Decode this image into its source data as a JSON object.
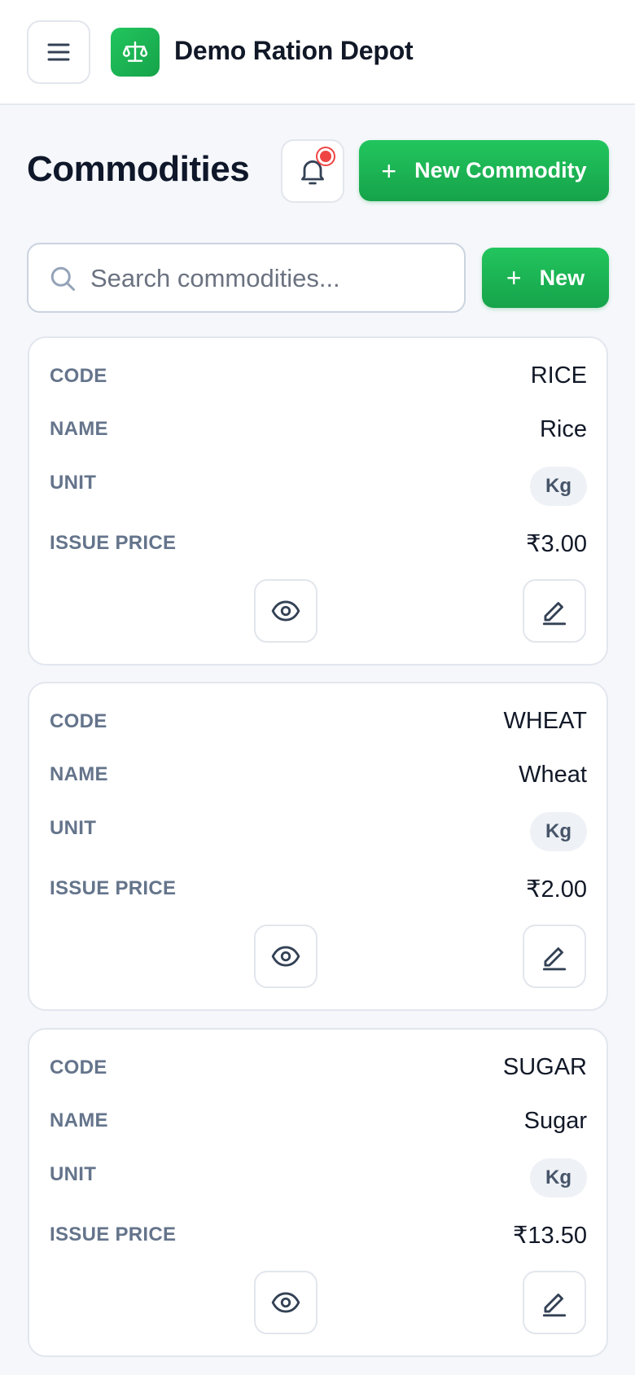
{
  "app": {
    "title": "Demo Ration Depot",
    "menu_icon": "hamburger-menu-icon",
    "logo_icon": "scale-balance-icon",
    "accent": "#22c55e"
  },
  "page": {
    "title": "Commodities",
    "notification_icon": "bell-icon",
    "has_unread": true,
    "new_commodity_label": "New Commodity",
    "plus": "+"
  },
  "search": {
    "placeholder": "Search commodities...",
    "value": "",
    "new_label": "New"
  },
  "labels": {
    "code": "CODE",
    "name": "NAME",
    "unit": "UNIT",
    "issue_price": "ISSUE PRICE"
  },
  "commodities": [
    {
      "code": "RICE",
      "name": "Rice",
      "unit": "Kg",
      "issue_price": "₹3.00"
    },
    {
      "code": "WHEAT",
      "name": "Wheat",
      "unit": "Kg",
      "issue_price": "₹2.00"
    },
    {
      "code": "SUGAR",
      "name": "Sugar",
      "unit": "Kg",
      "issue_price": "₹13.50"
    }
  ]
}
